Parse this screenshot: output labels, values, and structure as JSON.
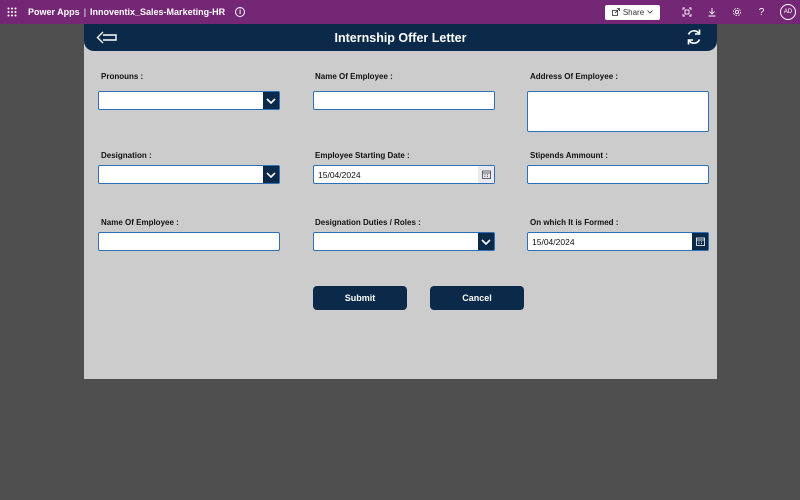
{
  "topbar": {
    "app_name": "Power Apps",
    "separator": "|",
    "environment": "Innoventix_Sales-Marketing-HR",
    "info_glyph": "i",
    "share_label": "Share",
    "avatar_initials": "AD",
    "help_glyph": "?",
    "color": "#742774"
  },
  "header": {
    "title": "Internship Offer Letter",
    "color": "#0b2a4a"
  },
  "form": {
    "pronouns": {
      "label": "Pronouns :",
      "value": ""
    },
    "name_of_employee": {
      "label": "Name Of Employee :",
      "value": ""
    },
    "address_of_employee": {
      "label": "Address Of Employee :",
      "value": ""
    },
    "designation": {
      "label": "Designation :",
      "value": ""
    },
    "employee_starting_date": {
      "label": "Employee Starting Date :",
      "value": "15/04/2024"
    },
    "stipends_amount": {
      "label": "Stipends Ammount :",
      "value": ""
    },
    "name_of_employee_2": {
      "label": "Name Of Employee :",
      "value": ""
    },
    "designation_duties": {
      "label": "Designation Duties / Roles :",
      "value": ""
    },
    "formed_date": {
      "label": "On which It is Formed :",
      "value": "15/04/2024"
    }
  },
  "buttons": {
    "submit": "Submit",
    "cancel": "Cancel"
  },
  "icons": [
    "app-launcher-icon",
    "info-icon",
    "share-icon",
    "fit-screen-icon",
    "download-icon",
    "settings-icon",
    "help-icon",
    "back-arrow-icon",
    "refresh-icon",
    "chevron-down-icon",
    "calendar-icon"
  ]
}
